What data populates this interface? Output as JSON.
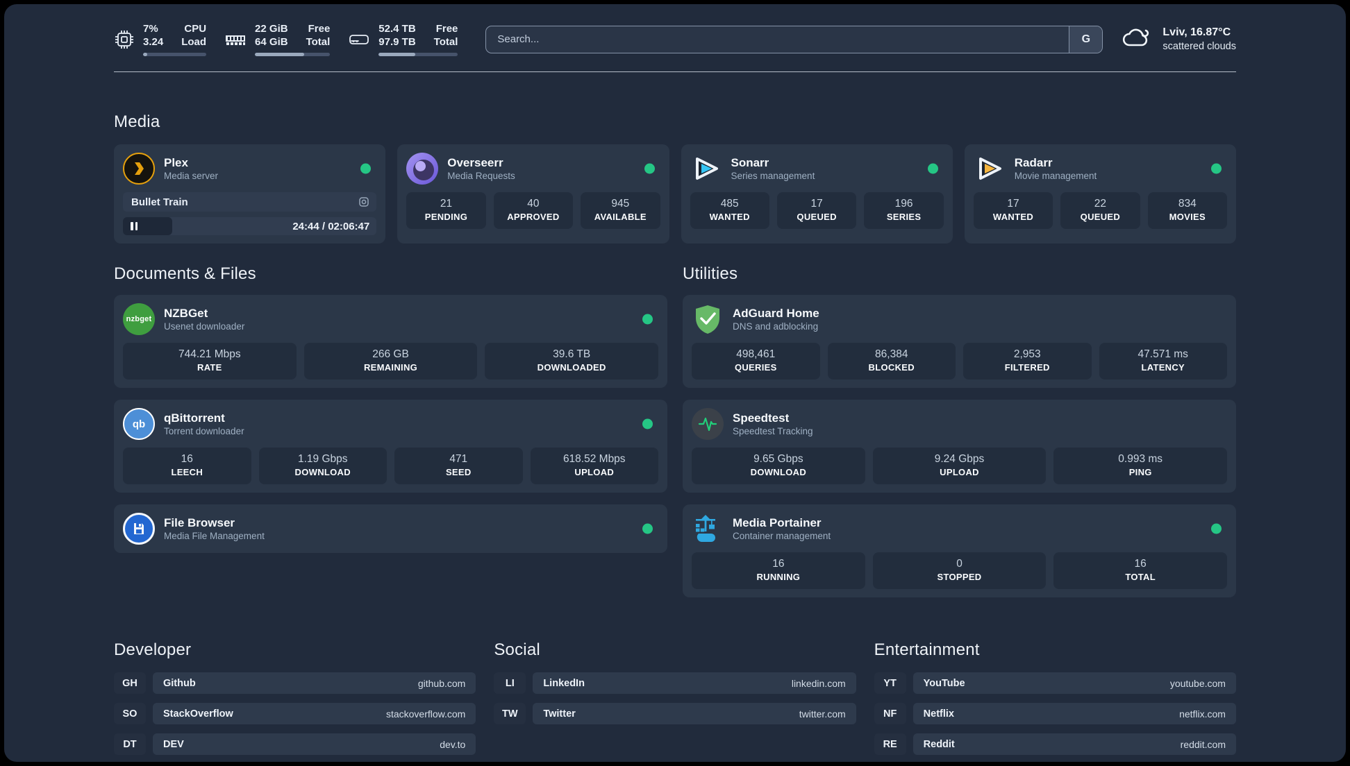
{
  "colors": {
    "status_green": "#25c685",
    "plex_amber": "#e5a00d",
    "sonarr_cyan": "#35c5f4",
    "radarr_orange": "#f5b53f",
    "adguard_green": "#67b967",
    "portainer_blue": "#2fa8e1",
    "speedtest_pulse": "#21d07a"
  },
  "topbar": {
    "cpu": {
      "value_top": "7%",
      "value_bottom": "3.24",
      "label_top": "CPU",
      "label_bottom": "Load",
      "progress": 7
    },
    "ram": {
      "value_top": "22 GiB",
      "value_bottom": "64 GiB",
      "label_top": "Free",
      "label_bottom": "Total",
      "progress": 66
    },
    "disk": {
      "value_top": "52.4 TB",
      "value_bottom": "97.9 TB",
      "label_top": "Free",
      "label_bottom": "Total",
      "progress": 46
    },
    "search": {
      "placeholder": "Search...",
      "engine_button": "G"
    },
    "weather": {
      "location": "Lviv, 16.87°C",
      "condition": "scattered clouds"
    }
  },
  "headings": {
    "media": "Media",
    "documents": "Documents & Files",
    "utilities": "Utilities",
    "developer": "Developer",
    "social": "Social",
    "entertainment": "Entertainment"
  },
  "apps": {
    "plex": {
      "name": "Plex",
      "desc": "Media server",
      "player": {
        "title": "Bullet Train",
        "time": "24:44 / 02:06:47"
      }
    },
    "overseerr": {
      "name": "Overseerr",
      "desc": "Media Requests",
      "stats": [
        {
          "value": "21",
          "label": "PENDING"
        },
        {
          "value": "40",
          "label": "APPROVED"
        },
        {
          "value": "945",
          "label": "AVAILABLE"
        }
      ]
    },
    "sonarr": {
      "name": "Sonarr",
      "desc": "Series management",
      "stats": [
        {
          "value": "485",
          "label": "WANTED"
        },
        {
          "value": "17",
          "label": "QUEUED"
        },
        {
          "value": "196",
          "label": "SERIES"
        }
      ]
    },
    "radarr": {
      "name": "Radarr",
      "desc": "Movie management",
      "stats": [
        {
          "value": "17",
          "label": "WANTED"
        },
        {
          "value": "22",
          "label": "QUEUED"
        },
        {
          "value": "834",
          "label": "MOVIES"
        }
      ]
    },
    "nzbget": {
      "name": "NZBGet",
      "desc": "Usenet downloader",
      "icon_text": "nzbget",
      "stats": [
        {
          "value": "744.21 Mbps",
          "label": "RATE"
        },
        {
          "value": "266 GB",
          "label": "REMAINING"
        },
        {
          "value": "39.6 TB",
          "label": "DOWNLOADED"
        }
      ]
    },
    "qbittorrent": {
      "name": "qBittorrent",
      "desc": "Torrent downloader",
      "icon_text": "qb",
      "stats": [
        {
          "value": "16",
          "label": "LEECH"
        },
        {
          "value": "1.19 Gbps",
          "label": "DOWNLOAD"
        },
        {
          "value": "471",
          "label": "SEED"
        },
        {
          "value": "618.52 Mbps",
          "label": "UPLOAD"
        }
      ]
    },
    "filebrowser": {
      "name": "File Browser",
      "desc": "Media File Management"
    },
    "adguard": {
      "name": "AdGuard Home",
      "desc": "DNS and adblocking",
      "stats": [
        {
          "value": "498,461",
          "label": "QUERIES"
        },
        {
          "value": "86,384",
          "label": "BLOCKED"
        },
        {
          "value": "2,953",
          "label": "FILTERED"
        },
        {
          "value": "47.571 ms",
          "label": "LATENCY"
        }
      ]
    },
    "speedtest": {
      "name": "Speedtest",
      "desc": "Speedtest Tracking",
      "stats": [
        {
          "value": "9.65 Gbps",
          "label": "DOWNLOAD"
        },
        {
          "value": "9.24 Gbps",
          "label": "UPLOAD"
        },
        {
          "value": "0.993 ms",
          "label": "PING"
        }
      ]
    },
    "portainer": {
      "name": "Media Portainer",
      "desc": "Container management",
      "stats": [
        {
          "value": "16",
          "label": "RUNNING"
        },
        {
          "value": "0",
          "label": "STOPPED"
        },
        {
          "value": "16",
          "label": "TOTAL"
        }
      ]
    }
  },
  "links": {
    "developer": [
      {
        "tag": "GH",
        "name": "Github",
        "url": "github.com"
      },
      {
        "tag": "SO",
        "name": "StackOverflow",
        "url": "stackoverflow.com"
      },
      {
        "tag": "DT",
        "name": "DEV",
        "url": "dev.to"
      }
    ],
    "social": [
      {
        "tag": "LI",
        "name": "LinkedIn",
        "url": "linkedin.com"
      },
      {
        "tag": "TW",
        "name": "Twitter",
        "url": "twitter.com"
      }
    ],
    "entertainment": [
      {
        "tag": "YT",
        "name": "YouTube",
        "url": "youtube.com"
      },
      {
        "tag": "NF",
        "name": "Netflix",
        "url": "netflix.com"
      },
      {
        "tag": "RE",
        "name": "Reddit",
        "url": "reddit.com"
      }
    ]
  }
}
